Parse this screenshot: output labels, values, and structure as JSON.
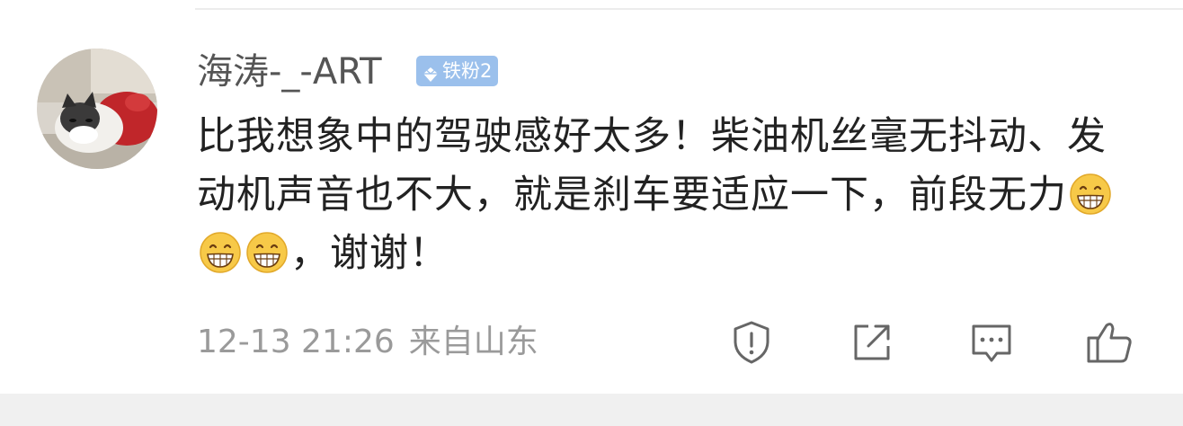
{
  "comment": {
    "username": "海涛-_-ART",
    "badge": {
      "label": "铁粉2",
      "icon": "diamond-icon",
      "color": "#9bc0ec"
    },
    "content_part1": "比我想象中的驾驶感好太多！柴油机丝毫无抖动、发动机声音也不大，就是刹车要适应一下，前段无力",
    "emojis": [
      "grin-emoji",
      "grin-emoji",
      "grin-emoji"
    ],
    "content_part2": "，谢谢！",
    "timestamp": "12-13 21:26",
    "location": "来自山东"
  },
  "actions": [
    {
      "name": "report",
      "icon": "shield-warning-icon"
    },
    {
      "name": "share",
      "icon": "share-icon"
    },
    {
      "name": "reply",
      "icon": "comment-icon"
    },
    {
      "name": "like",
      "icon": "thumbs-up-icon"
    }
  ],
  "colors": {
    "text": "#222222",
    "username": "#555555",
    "meta": "#9a9a9a",
    "icon": "#666666"
  }
}
